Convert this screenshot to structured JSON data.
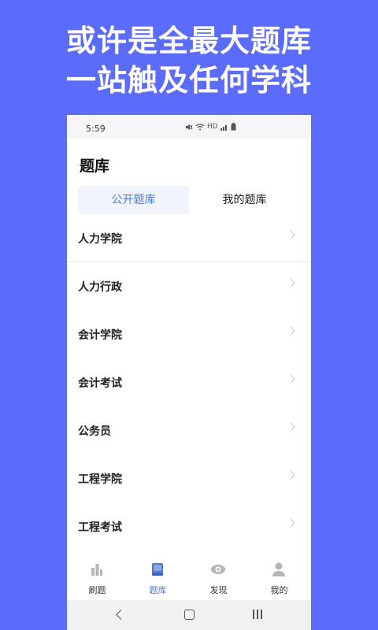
{
  "promo": {
    "line1": "或许是全最大题库",
    "line2": "一站触及任何学科"
  },
  "status_bar": {
    "time": "5:59",
    "icons": [
      "mute-icon",
      "wifi-icon",
      "hd-icon",
      "signal-icon",
      "battery-icon"
    ],
    "hd_text": "HD"
  },
  "header": {
    "title": "题库"
  },
  "tabs": [
    {
      "label": "公开题库",
      "active": true
    },
    {
      "label": "我的题库",
      "active": false
    }
  ],
  "list": [
    {
      "label": "人力学院"
    },
    {
      "label": "人力行政"
    },
    {
      "label": "会计学院"
    },
    {
      "label": "会计考试"
    },
    {
      "label": "公务员"
    },
    {
      "label": "工程学院"
    },
    {
      "label": "工程考试"
    }
  ],
  "bottom_nav": [
    {
      "label": "刷题",
      "icon": "bar-chart-icon",
      "active": false
    },
    {
      "label": "题库",
      "icon": "book-icon",
      "active": true
    },
    {
      "label": "发现",
      "icon": "eye-icon",
      "active": false
    },
    {
      "label": "我的",
      "icon": "user-icon",
      "active": false
    }
  ],
  "colors": {
    "background": "#5b6bfa",
    "accent": "#4d7ad8",
    "tab_active_bg": "#f1f5fb"
  }
}
